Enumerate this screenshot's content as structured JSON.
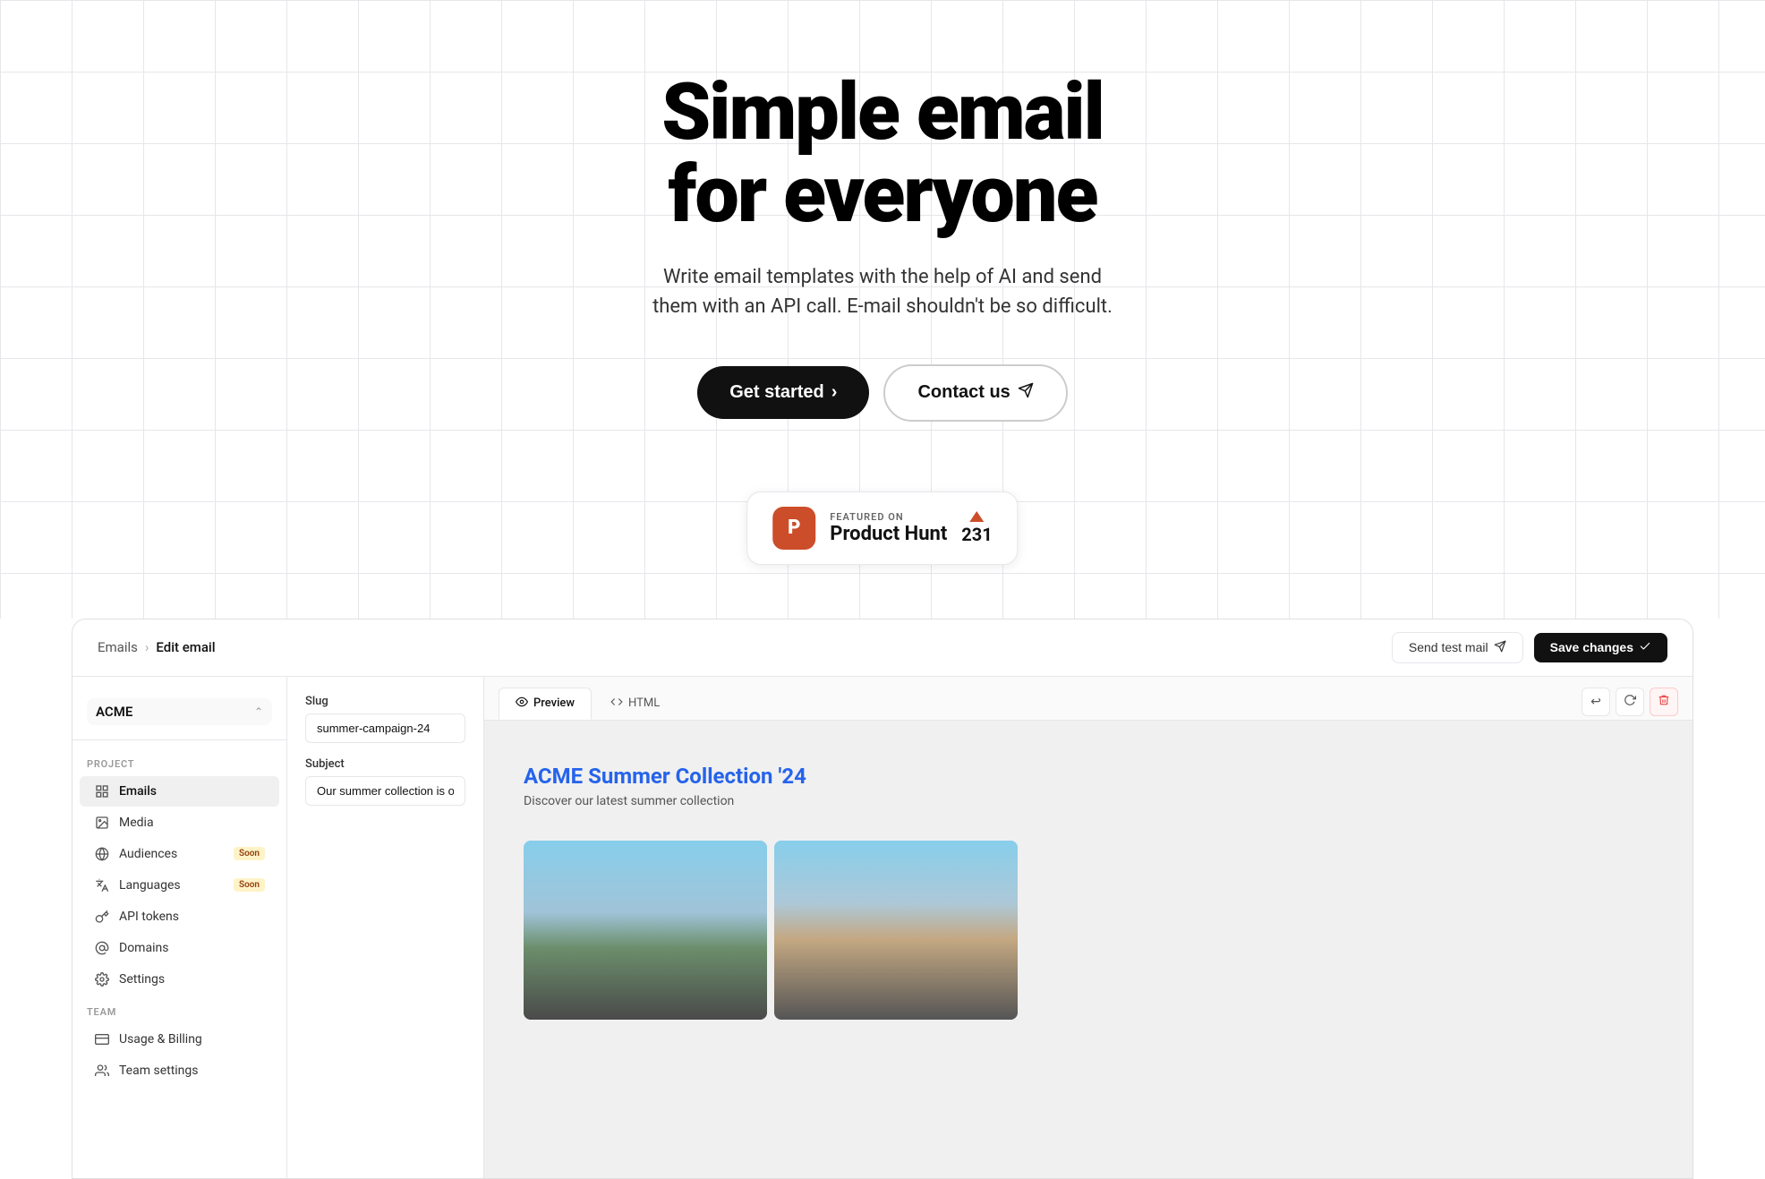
{
  "hero": {
    "title_line1": "Simple email",
    "title_line2": "for everyone",
    "subtitle": "Write email templates with the help of AI and send them with an API call. E-mail shouldn't be so difficult.",
    "get_started_label": "Get started",
    "contact_us_label": "Contact us"
  },
  "product_hunt": {
    "featured_label": "FEATURED ON",
    "name": "Product Hunt",
    "votes": "231"
  },
  "app": {
    "breadcrumb_parent": "Emails",
    "breadcrumb_current": "Edit email",
    "send_test_label": "Send test mail",
    "save_changes_label": "Save changes",
    "workspace_name": "ACME"
  },
  "sidebar": {
    "project_label": "PROJECT",
    "team_label": "TEAM",
    "items": [
      {
        "label": "Emails",
        "icon": "grid",
        "active": true
      },
      {
        "label": "Media",
        "icon": "image",
        "active": false
      },
      {
        "label": "Audiences",
        "icon": "globe",
        "active": false,
        "badge": "Soon"
      },
      {
        "label": "Languages",
        "icon": "translate",
        "active": false,
        "badge": "Soon"
      },
      {
        "label": "API tokens",
        "icon": "key",
        "active": false
      },
      {
        "label": "Domains",
        "icon": "at",
        "active": false
      },
      {
        "label": "Settings",
        "icon": "gear",
        "active": false
      }
    ],
    "team_items": [
      {
        "label": "Usage & Billing",
        "icon": "card"
      },
      {
        "label": "Team settings",
        "icon": "users"
      }
    ]
  },
  "form": {
    "slug_label": "Slug",
    "slug_value": "summer-campaign-24",
    "subject_label": "Subject",
    "subject_value": "Our summer collection is out now!"
  },
  "preview": {
    "preview_tab_label": "Preview",
    "html_tab_label": "HTML",
    "email_title": "ACME Summer Collection '24",
    "email_description": "Discover our latest summer collection"
  },
  "tabs": {
    "active": "Preview"
  }
}
